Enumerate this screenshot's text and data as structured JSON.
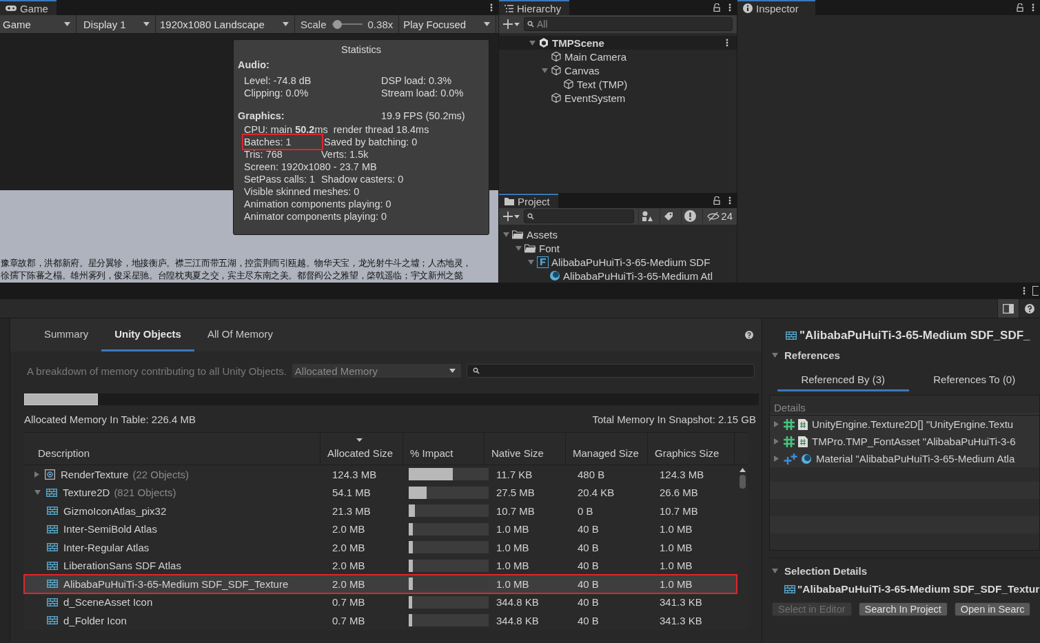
{
  "game_panel": {
    "tab": "Game",
    "view_dropdown": "Game",
    "display_dropdown": "Display 1",
    "resolution_dropdown": "1920x1080 Landscape",
    "scale": {
      "label": "Scale",
      "level": 0.05,
      "reading": "0.38x"
    },
    "play_mode_dropdown": "Play Focused",
    "scene_text": [
      "豫章故郡，洪都新府。星分翼轸，地接衡庐。襟三江而带五湖，控蛮荆而引瓯越。物华天宝，龙光射牛斗之墟；人杰地灵，",
      "徐孺下陈蕃之榻。雄州雾列，俊采星驰。台隍枕夷夏之交，宾主尽东南之美。都督阎公之雅望，棨戟遥临；宇文新州之懿"
    ]
  },
  "statistics": {
    "title": "Statistics",
    "audio_heading": "Audio:",
    "audio_rows": [
      {
        "left": "Level: -74.8 dB",
        "right": "DSP load: 0.3%"
      },
      {
        "left": "Clipping: 0.0%",
        "right": "Stream load: 0.0%"
      }
    ],
    "graphics_heading": "Graphics:",
    "fps": "19.9 FPS (50.2ms)",
    "cpu": "CPU: main **50.2**ms  render thread 18.4ms",
    "graphics_rows": [
      {
        "left": "Batches: 1",
        "right": "Saved by batching: 0",
        "highlighted": true
      },
      {
        "left": "Tris: 768",
        "right": "Verts: 1.5k",
        "highlighted": false
      },
      {
        "left": "Screen: 1920x1080 - 23.7 MB",
        "highlighted": false
      },
      {
        "left": "SetPass calls: 1",
        "right": "Shadow casters: 0",
        "highlighted": false
      },
      {
        "left": "Visible skinned meshes: 0",
        "highlighted": false
      },
      {
        "left": "Animation components playing: 0",
        "highlighted": false
      },
      {
        "left": "Animator components playing: 0",
        "highlighted": false
      }
    ]
  },
  "hierarchy": {
    "tab": "Hierarchy",
    "search_placeholder": "All",
    "tree": [
      {
        "name": "TMPScene",
        "kind": "scene",
        "expanded": true,
        "children": [
          {
            "name": "Main Camera",
            "kind": "object"
          },
          {
            "name": "Canvas",
            "kind": "object",
            "expanded": true,
            "children": [
              {
                "name": "Text (TMP)",
                "kind": "object"
              }
            ]
          },
          {
            "name": "EventSystem",
            "kind": "object"
          }
        ]
      }
    ]
  },
  "project": {
    "tab": "Project",
    "hidden_count": "24",
    "tree": [
      {
        "name": "Assets",
        "kind": "folder",
        "expanded": true,
        "children": [
          {
            "name": "Font",
            "kind": "folder",
            "expanded": true,
            "children": [
              {
                "name": "AlibabaPuHuiTi-3-65-Medium SDF",
                "kind": "font",
                "expanded": true,
                "children": [
                  {
                    "name": "AlibabaPuHuiTi-3-65-Medium Atl",
                    "kind": "material"
                  }
                ]
              }
            ]
          }
        ]
      }
    ]
  },
  "inspector": {
    "tab": "Inspector"
  },
  "memory_profiler": {
    "tabs": [
      {
        "label": "Summary",
        "selected": false
      },
      {
        "label": "Unity Objects",
        "selected": true
      },
      {
        "label": "All Of Memory",
        "selected": false
      }
    ],
    "description": "A breakdown of memory contributing to all Unity Objects.",
    "memory_dropdown": "Allocated Memory",
    "memory_bar": {
      "level": 0.1
    },
    "table_total": "Allocated Memory In Table: 226.4 MB",
    "snapshot_total": "Total Memory In Snapshot: 2.15 GB",
    "columns": [
      {
        "label": "Description",
        "sorted": false
      },
      {
        "label": "Allocated Size",
        "sorted": true
      },
      {
        "label": "% Impact",
        "sorted": false
      },
      {
        "label": "Native Size",
        "sorted": false
      },
      {
        "label": "Managed Size",
        "sorted": false
      },
      {
        "label": "Graphics Size",
        "sorted": false
      }
    ],
    "rows": [
      {
        "name": "RenderTexture",
        "count": "(22 Objects)",
        "kind": "render_texture",
        "allocated": "124.3 MB",
        "level": 0.55,
        "native": "11.7 KB",
        "managed": "480 B",
        "graphics": "124.3 MB",
        "expanded": false,
        "selected": false,
        "highlighted": false
      },
      {
        "name": "Texture2D",
        "count": "(821 Objects)",
        "kind": "texture",
        "allocated": "54.1 MB",
        "level": 0.22,
        "native": "27.5 MB",
        "managed": "20.4 KB",
        "graphics": "26.6 MB",
        "expanded": true,
        "selected": false,
        "highlighted": false,
        "children": [
          {
            "name": "GizmoIconAtlas_pix32",
            "kind": "texture",
            "allocated": "21.3 MB",
            "level": 0.08,
            "native": "10.7 MB",
            "managed": "0 B",
            "graphics": "10.7 MB",
            "selected": false,
            "highlighted": false
          },
          {
            "name": "Inter-SemiBold Atlas",
            "kind": "texture",
            "allocated": "2.0 MB",
            "level": 0.05,
            "native": "1.0 MB",
            "managed": "40 B",
            "graphics": "1.0 MB",
            "selected": false,
            "highlighted": false
          },
          {
            "name": "Inter-Regular Atlas",
            "kind": "texture",
            "allocated": "2.0 MB",
            "level": 0.05,
            "native": "1.0 MB",
            "managed": "40 B",
            "graphics": "1.0 MB",
            "selected": false,
            "highlighted": false
          },
          {
            "name": "LiberationSans SDF Atlas",
            "kind": "texture",
            "allocated": "2.0 MB",
            "level": 0.05,
            "native": "1.0 MB",
            "managed": "40 B",
            "graphics": "1.0 MB",
            "selected": false,
            "highlighted": false
          },
          {
            "name": "AlibabaPuHuiTi-3-65-Medium SDF_SDF_Texture",
            "kind": "texture",
            "allocated": "2.0 MB",
            "level": 0.05,
            "native": "1.0 MB",
            "managed": "40 B",
            "graphics": "1.0 MB",
            "selected": true,
            "highlighted": true
          },
          {
            "name": "d_SceneAsset Icon",
            "kind": "texture",
            "allocated": "0.7 MB",
            "level": 0.04,
            "native": "344.8 KB",
            "managed": "40 B",
            "graphics": "341.3 KB",
            "selected": false,
            "highlighted": false
          },
          {
            "name": "d_Folder Icon",
            "kind": "texture",
            "allocated": "0.7 MB",
            "level": 0.04,
            "native": "344.8 KB",
            "managed": "40 B",
            "graphics": "341.3 KB",
            "selected": false,
            "highlighted": false
          }
        ]
      }
    ]
  },
  "details_panel": {
    "title": "\"AlibabaPuHuiTi-3-65-Medium SDF_SDF_",
    "references_heading": "References",
    "references_expanded": true,
    "tabs": [
      {
        "label": "Referenced By (3)",
        "selected": true
      },
      {
        "label": "References To (0)",
        "selected": false
      }
    ],
    "details_header": "Details",
    "references": [
      {
        "kind": "script",
        "text": "UnityEngine.Texture2D[] \"UnityEngine.Textu"
      },
      {
        "kind": "script",
        "text": "TMPro.TMP_FontAsset \"AlibabaPuHuiTi-3-6"
      },
      {
        "kind": "material",
        "text": "Material \"AlibabaPuHuiTi-3-65-Medium Atla"
      }
    ],
    "selection_heading": "Selection Details",
    "selection_expanded": true,
    "selection_name": "\"AlibabaPuHuiTi-3-65-Medium SDF_SDF_Textur",
    "buttons": [
      {
        "label": "Select in Editor",
        "disabled": true
      },
      {
        "label": "Search In Project",
        "disabled": false
      },
      {
        "label": "Open in Searc",
        "disabled": false
      }
    ]
  }
}
